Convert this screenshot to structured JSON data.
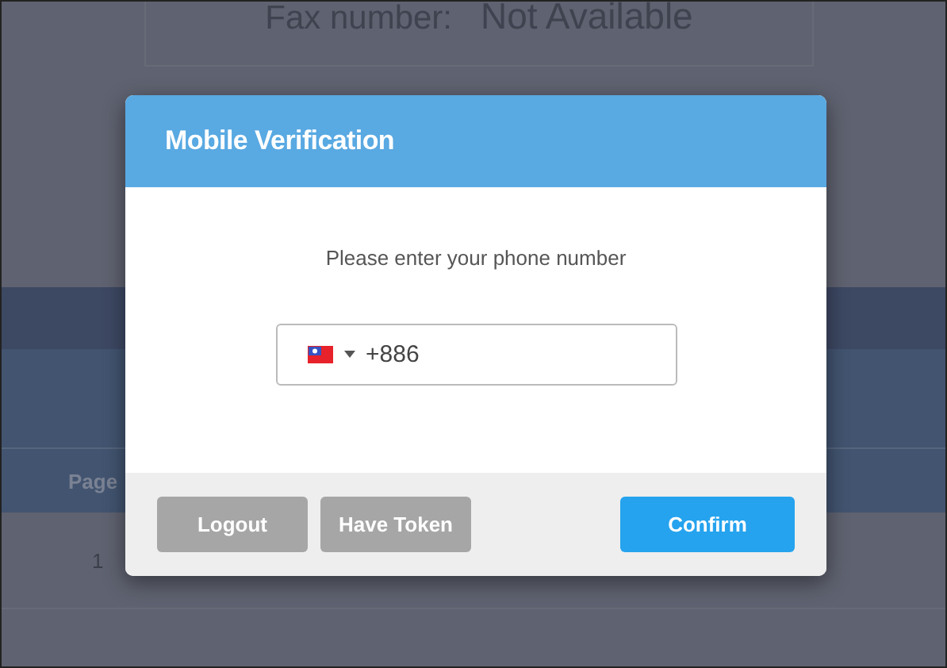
{
  "background": {
    "fax_label": "Fax number:",
    "fax_value": "Not Available",
    "table_header": "Page",
    "row_number": "1"
  },
  "dialog": {
    "title": "Mobile Verification",
    "prompt": "Please enter your phone number",
    "phone_field": {
      "value": "+886"
    },
    "buttons": [
      {
        "label": "Logout",
        "kind": "secondary"
      },
      {
        "label": "Have Token",
        "kind": "secondary"
      },
      {
        "label": "Confirm",
        "kind": "primary"
      }
    ]
  }
}
